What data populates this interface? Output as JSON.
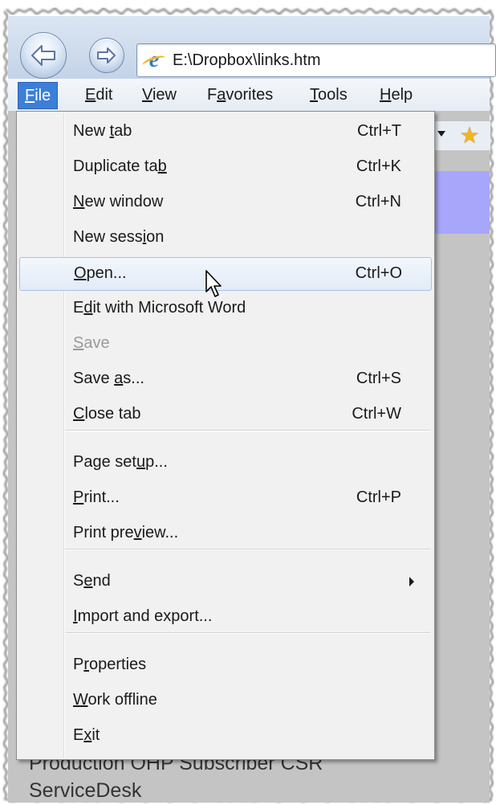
{
  "address_bar": {
    "url": "E:\\Dropbox\\links.htm",
    "icon": "ie-page-icon"
  },
  "menubar": {
    "items": [
      {
        "prefix": "",
        "mnemonic": "F",
        "suffix": "ile",
        "active": true
      },
      {
        "prefix": "",
        "mnemonic": "E",
        "suffix": "dit"
      },
      {
        "prefix": "",
        "mnemonic": "V",
        "suffix": "iew"
      },
      {
        "prefix": "F",
        "mnemonic": "a",
        "suffix": "vorites"
      },
      {
        "prefix": "",
        "mnemonic": "T",
        "suffix": "ools"
      },
      {
        "prefix": "",
        "mnemonic": "H",
        "suffix": "elp"
      }
    ]
  },
  "file_menu": {
    "items": [
      {
        "pre": "New ",
        "u": "t",
        "post": "ab",
        "shortcut": "Ctrl+T"
      },
      {
        "pre": "Duplicate ta",
        "u": "b",
        "post": "",
        "shortcut": "Ctrl+K"
      },
      {
        "pre": "",
        "u": "N",
        "post": "ew window",
        "shortcut": "Ctrl+N"
      },
      {
        "pre": "New sess",
        "u": "i",
        "post": "on",
        "shortcut": ""
      },
      {
        "pre": "",
        "u": "O",
        "post": "pen...",
        "shortcut": "Ctrl+O",
        "highlighted": true
      },
      {
        "pre": "E",
        "u": "d",
        "post": "it with Microsoft Word",
        "shortcut": ""
      },
      {
        "pre": "",
        "u": "S",
        "post": "ave",
        "shortcut": "",
        "disabled": true
      },
      {
        "pre": "Save ",
        "u": "a",
        "post": "s...",
        "shortcut": "Ctrl+S"
      },
      {
        "pre": "",
        "u": "C",
        "post": "lose tab",
        "shortcut": "Ctrl+W"
      },
      {
        "pre": "Page set",
        "u": "u",
        "post": "p...",
        "shortcut": ""
      },
      {
        "pre": "",
        "u": "P",
        "post": "rint...",
        "shortcut": "Ctrl+P"
      },
      {
        "pre": "Print pre",
        "u": "v",
        "post": "iew...",
        "shortcut": ""
      },
      {
        "pre": "S",
        "u": "e",
        "post": "nd",
        "shortcut": "",
        "submenu": true
      },
      {
        "pre": "",
        "u": "I",
        "post": "mport and export...",
        "shortcut": ""
      },
      {
        "pre": "P",
        "u": "r",
        "post": "operties",
        "shortcut": ""
      },
      {
        "pre": "",
        "u": "W",
        "post": "ork offline",
        "shortcut": ""
      },
      {
        "pre": "E",
        "u": "x",
        "post": "it",
        "shortcut": ""
      }
    ]
  },
  "page": {
    "text_line_1": "Production OHP Subscriber CSR",
    "text_line_2": "ServiceDesk",
    "banner_color": "#a7a6fb"
  },
  "colors": {
    "menu_active": "#3c7fd8",
    "highlight_border": "#a9c3e6"
  }
}
